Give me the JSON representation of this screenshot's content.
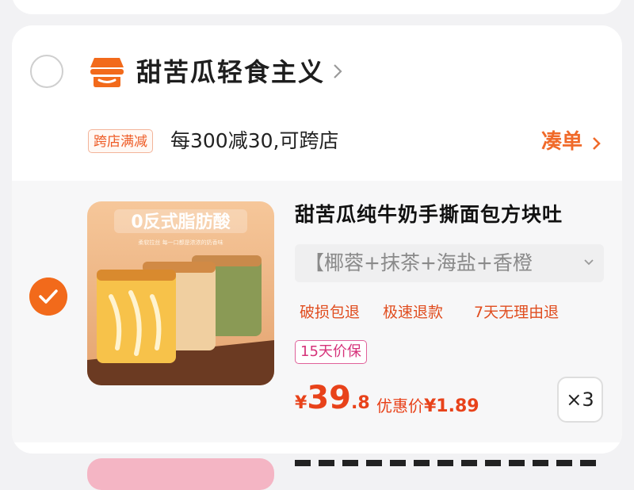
{
  "store": {
    "name": "甜苦瓜轻食主义",
    "promo_tag": "跨店满减",
    "promo_text": "每300减30,可跨店",
    "cou_dan_label": "凑单",
    "colors": {
      "accent": "#f26a1b",
      "price": "#e8421a"
    },
    "icons": {
      "radio": "unchecked-radio-icon",
      "logo": "shop-logo-icon",
      "chevron": "chevron-right-icon"
    }
  },
  "product": {
    "checked": true,
    "title": "甜苦瓜纯牛奶手撕面包方块吐",
    "variant": "【椰蓉+抹茶+海盐+香橙",
    "services": [
      "破损包退",
      "极速退款",
      "7天无理由退"
    ],
    "badge": "15天价保",
    "price": {
      "symbol": "¥",
      "integer": "39",
      "decimal": ".8"
    },
    "discount": {
      "label": "优惠价",
      "value": "¥1.89"
    },
    "quantity": "×3",
    "image_text": {
      "headline": "0反式脂肪酸",
      "subline": "柔软拉丝 每一口都是浓浓的奶香味"
    }
  }
}
